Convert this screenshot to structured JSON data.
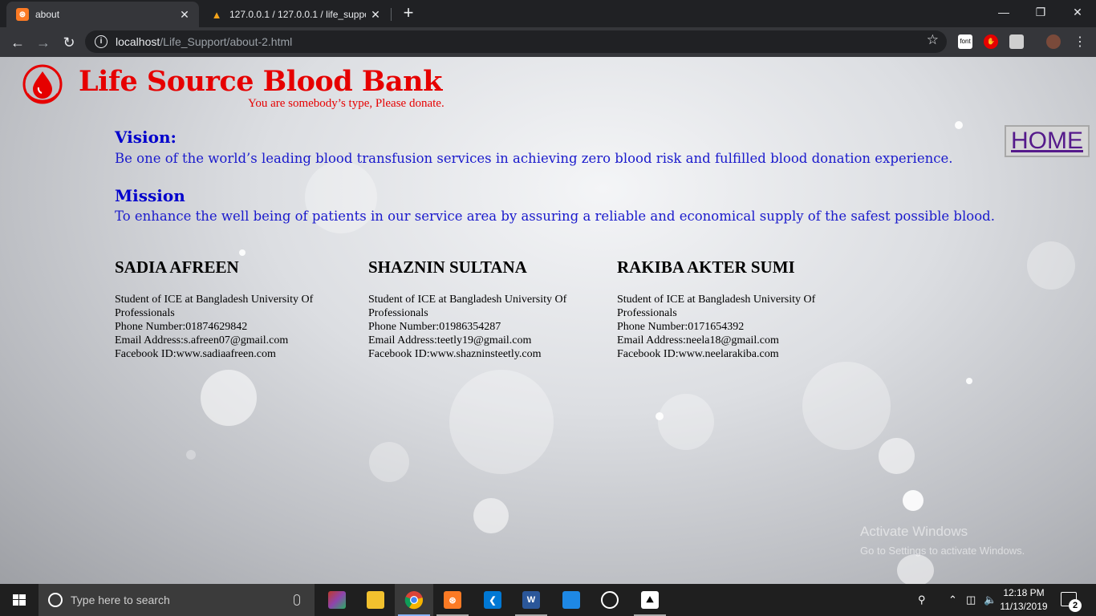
{
  "browser": {
    "tabs": [
      {
        "title": "about",
        "icon": "xampp-icon"
      },
      {
        "title": "127.0.0.1 / 127.0.0.1 / life_suppor",
        "icon": "phpmyadmin-icon"
      }
    ],
    "url_host": "localhost",
    "url_path": "/Life_Support/about-2.html",
    "extension_label": "font"
  },
  "header": {
    "brand": "Life Source Blood Bank",
    "tagline": "You are somebody’s type, Please donate."
  },
  "nav": {
    "home_label": "HOME"
  },
  "vision": {
    "title": "Vision:",
    "text": "Be one of the world’s leading blood transfusion services in achieving zero blood risk and fulfilled blood donation experience."
  },
  "mission": {
    "title": "Mission",
    "text": "To enhance the well being of patients in our service area by assuring a reliable and economical supply of the safest possible blood."
  },
  "members": [
    {
      "name": "SADIA AFREEN",
      "line1": "Student of ICE at Bangladesh University Of",
      "line2": "Professionals",
      "phone": "Phone Number:01874629842",
      "email": "Email Address:s.afreen07@gmail.com",
      "facebook": "Facebook ID:www.sadiaafreen.com"
    },
    {
      "name": "SHAZNIN SULTANA",
      "line1": "Student of ICE at Bangladesh University Of",
      "line2": "Professionals",
      "phone": "Phone Number:01986354287",
      "email": "Email Address:teetly19@gmail.com",
      "facebook": "Facebook ID:www.shazninsteetly.com"
    },
    {
      "name": "RAKIBA AKTER SUMI",
      "line1": "Student of ICE at Bangladesh University Of",
      "line2": "Professionals",
      "phone": "Phone Number:0171654392",
      "email": "Email Address:neela18@gmail.com",
      "facebook": "Facebook ID:www.neelarakiba.com"
    }
  ],
  "watermark": {
    "line1": "Activate Windows",
    "line2": "Go to Settings to activate Windows."
  },
  "taskbar": {
    "search_placeholder": "Type here to search",
    "time": "12:18 PM",
    "date": "11/13/2019",
    "notification_count": "2"
  },
  "colors": {
    "brand_red": "#e60000",
    "heading_blue": "#0000cc",
    "link_purple": "#551a8b"
  }
}
